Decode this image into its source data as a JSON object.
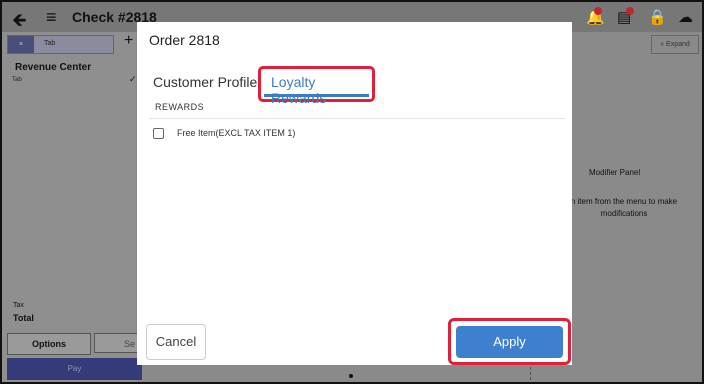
{
  "app": {
    "check_title": "Check #2818",
    "back_icon": "back-arrow-icon",
    "menu_icon": "hamburger-menu-icon"
  },
  "topbar_icons": [
    "bell-icon",
    "receipt-icon",
    "lock-icon",
    "cloud-icon"
  ],
  "left_panel": {
    "tab_label": "Tab",
    "add_label": "+",
    "revenue_center": "Revenue Center",
    "small_tab": "Tab",
    "tax_label": "Tax",
    "total_label": "Total",
    "options_label": "Options",
    "second_button_label": "Se",
    "pay_label": "Pay"
  },
  "right_panel": {
    "expand_label": "« Expand",
    "modifier_title": "Modifier Panel",
    "modifier_hint": "n item from the menu to make modifications"
  },
  "modal": {
    "title": "Order 2818",
    "tabs": [
      {
        "label": "Customer Profile",
        "active": false
      },
      {
        "label": "Loyalty Rewards",
        "active": true
      }
    ],
    "section_header": "REWARDS",
    "items": [
      {
        "label": "Free Item(EXCL TAX ITEM 1)",
        "checked": false
      }
    ],
    "cancel_label": "Cancel",
    "apply_label": "Apply"
  },
  "colors": {
    "accent": "#3d80d0",
    "highlight": "#e0203a"
  }
}
